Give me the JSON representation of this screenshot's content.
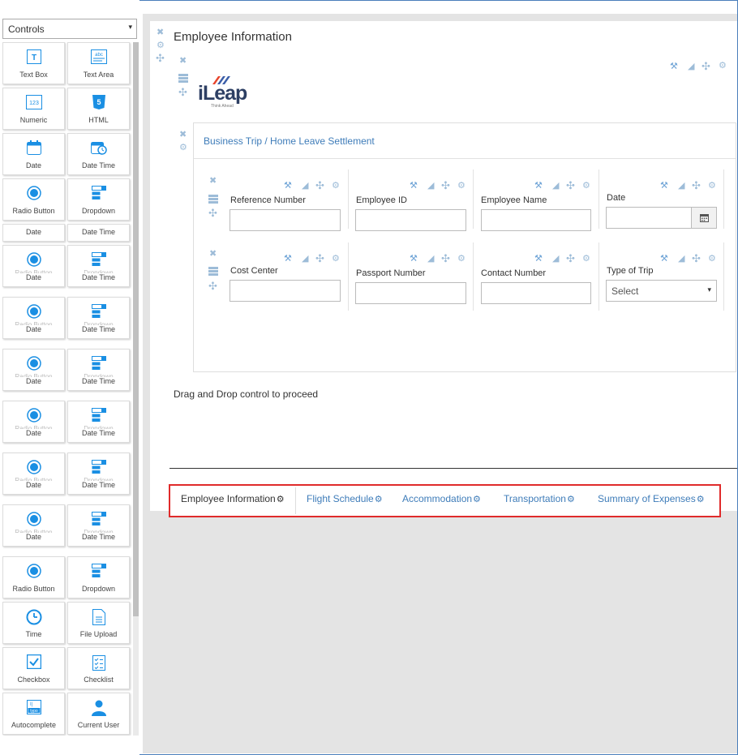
{
  "palette": {
    "dropdown_label": "Controls",
    "dropdown_arrow": "▾",
    "tiles": [
      {
        "label": "Text Box",
        "icon": "text-box-icon"
      },
      {
        "label": "Text Area",
        "icon": "text-area-icon"
      },
      {
        "label": "Numeric",
        "icon": "numeric-icon"
      },
      {
        "label": "HTML",
        "icon": "html-icon"
      },
      {
        "label": "Date",
        "icon": "date-icon"
      },
      {
        "label": "Date Time",
        "icon": "date-time-icon"
      },
      {
        "label": "Radio Button",
        "icon": "radio-button-icon"
      },
      {
        "label": "Dropdown",
        "icon": "dropdown-icon"
      },
      {
        "label": "Date",
        "icon": ""
      },
      {
        "label": "Date Time",
        "icon": ""
      },
      {
        "label": "Date",
        "icon": "radio-button-icon"
      },
      {
        "label": "Date Time",
        "icon": "dropdown-icon"
      },
      {
        "label": "Date",
        "icon": "radio-button-icon"
      },
      {
        "label": "Date Time",
        "icon": "dropdown-icon"
      },
      {
        "label": "Date",
        "icon": "radio-button-icon"
      },
      {
        "label": "Date Time",
        "icon": "dropdown-icon"
      },
      {
        "label": "Date",
        "icon": "radio-button-icon"
      },
      {
        "label": "Date Time",
        "icon": "dropdown-icon"
      },
      {
        "label": "Date",
        "icon": "radio-button-icon"
      },
      {
        "label": "Date Time",
        "icon": "dropdown-icon"
      },
      {
        "label": "Date",
        "icon": "radio-button-icon"
      },
      {
        "label": "Date Time",
        "icon": "dropdown-icon"
      },
      {
        "label": "Radio Button",
        "icon": "radio-button-icon"
      },
      {
        "label": "Dropdown",
        "icon": "dropdown-icon"
      },
      {
        "label": "Time",
        "icon": "clock-icon"
      },
      {
        "label": "File Upload",
        "icon": "file-upload-icon"
      },
      {
        "label": "Checkbox",
        "icon": "checkbox-icon"
      },
      {
        "label": "Checklist",
        "icon": "checklist-icon"
      },
      {
        "label": "Autocomplete",
        "icon": "autocomplete-icon"
      },
      {
        "label": "Current User",
        "icon": "user-icon"
      }
    ]
  },
  "form": {
    "title": "Employee Information",
    "logo_text": "iLeap",
    "logo_tagline": "Think Ahead",
    "section_title": "Business Trip / Home Leave Settlement",
    "fields": {
      "reference_number": "Reference Number",
      "employee_id": "Employee ID",
      "employee_name": "Employee Name",
      "date": "Date",
      "cost_center": "Cost Center",
      "passport_number": "Passport Number",
      "contact_number": "Contact Number",
      "type_of_trip": "Type of Trip",
      "type_of_trip_value": "Select"
    },
    "drag_drop_hint": "Drag and Drop control to proceed"
  },
  "tabs": [
    {
      "label": "Employee Information",
      "active": true
    },
    {
      "label": "Flight Schedule",
      "active": false
    },
    {
      "label": "Accommodation",
      "active": false
    },
    {
      "label": "Transportation",
      "active": false
    },
    {
      "label": "Summary of Expenses",
      "active": false
    }
  ],
  "glyphs": {
    "close": "✖",
    "gear": "⚙",
    "move": "✣",
    "wrench": "🔧",
    "trash": "🗑",
    "arrow": "▾"
  },
  "colors": {
    "accent": "#3e7cb9",
    "tool": "#9dbcd8",
    "highlight": "#e02b2b",
    "icon_blue": "#1a8fe3"
  }
}
